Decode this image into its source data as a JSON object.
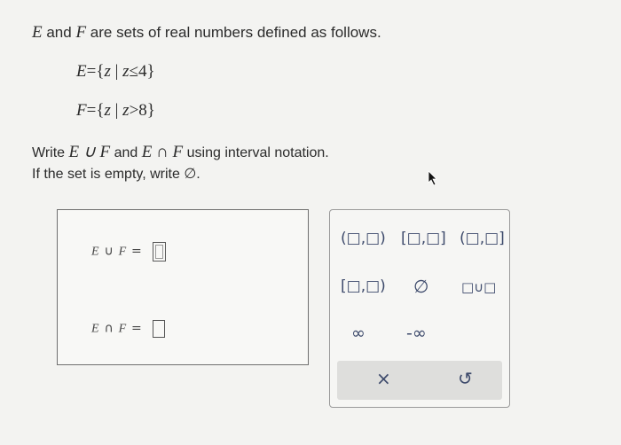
{
  "problem": {
    "intro_math_e": "E",
    "intro_and": "and",
    "intro_math_f": "F",
    "intro_rest": "are sets of real numbers defined as follows.",
    "set_e": {
      "name": "E",
      "eq": "=",
      "body_open": "{",
      "var": "z",
      "bar": "|",
      "cond_var": "z",
      "cond_op": "≤",
      "cond_val": "4",
      "body_close": "}"
    },
    "set_f": {
      "name": "F",
      "eq": "=",
      "body_open": "{",
      "var": "z",
      "bar": "|",
      "cond_var": "z",
      "cond_op": ">",
      "cond_val": "8",
      "body_close": "}"
    },
    "instruction_1_prefix": "Write",
    "instruction_1_union": "E ∪ F",
    "instruction_1_and": "and",
    "instruction_1_inter": "E ∩ F",
    "instruction_1_suffix": "using interval notation.",
    "instruction_2": "If the set is empty, write ∅."
  },
  "answers": {
    "union_label": "E",
    "union_op": "∪",
    "union_label2": "F",
    "union_eq": "=",
    "inter_label": "E",
    "inter_op": "∩",
    "inter_label2": "F",
    "inter_eq": "="
  },
  "palette": {
    "open_open": "(□,□)",
    "closed_closed": "[□,□]",
    "open_closed": "(□,□]",
    "closed_open": "[□,□)",
    "empty_set": "∅",
    "union": "□∪□",
    "infinity": "∞",
    "neg_infinity": "-∞",
    "clear": "×",
    "undo": "↺"
  }
}
